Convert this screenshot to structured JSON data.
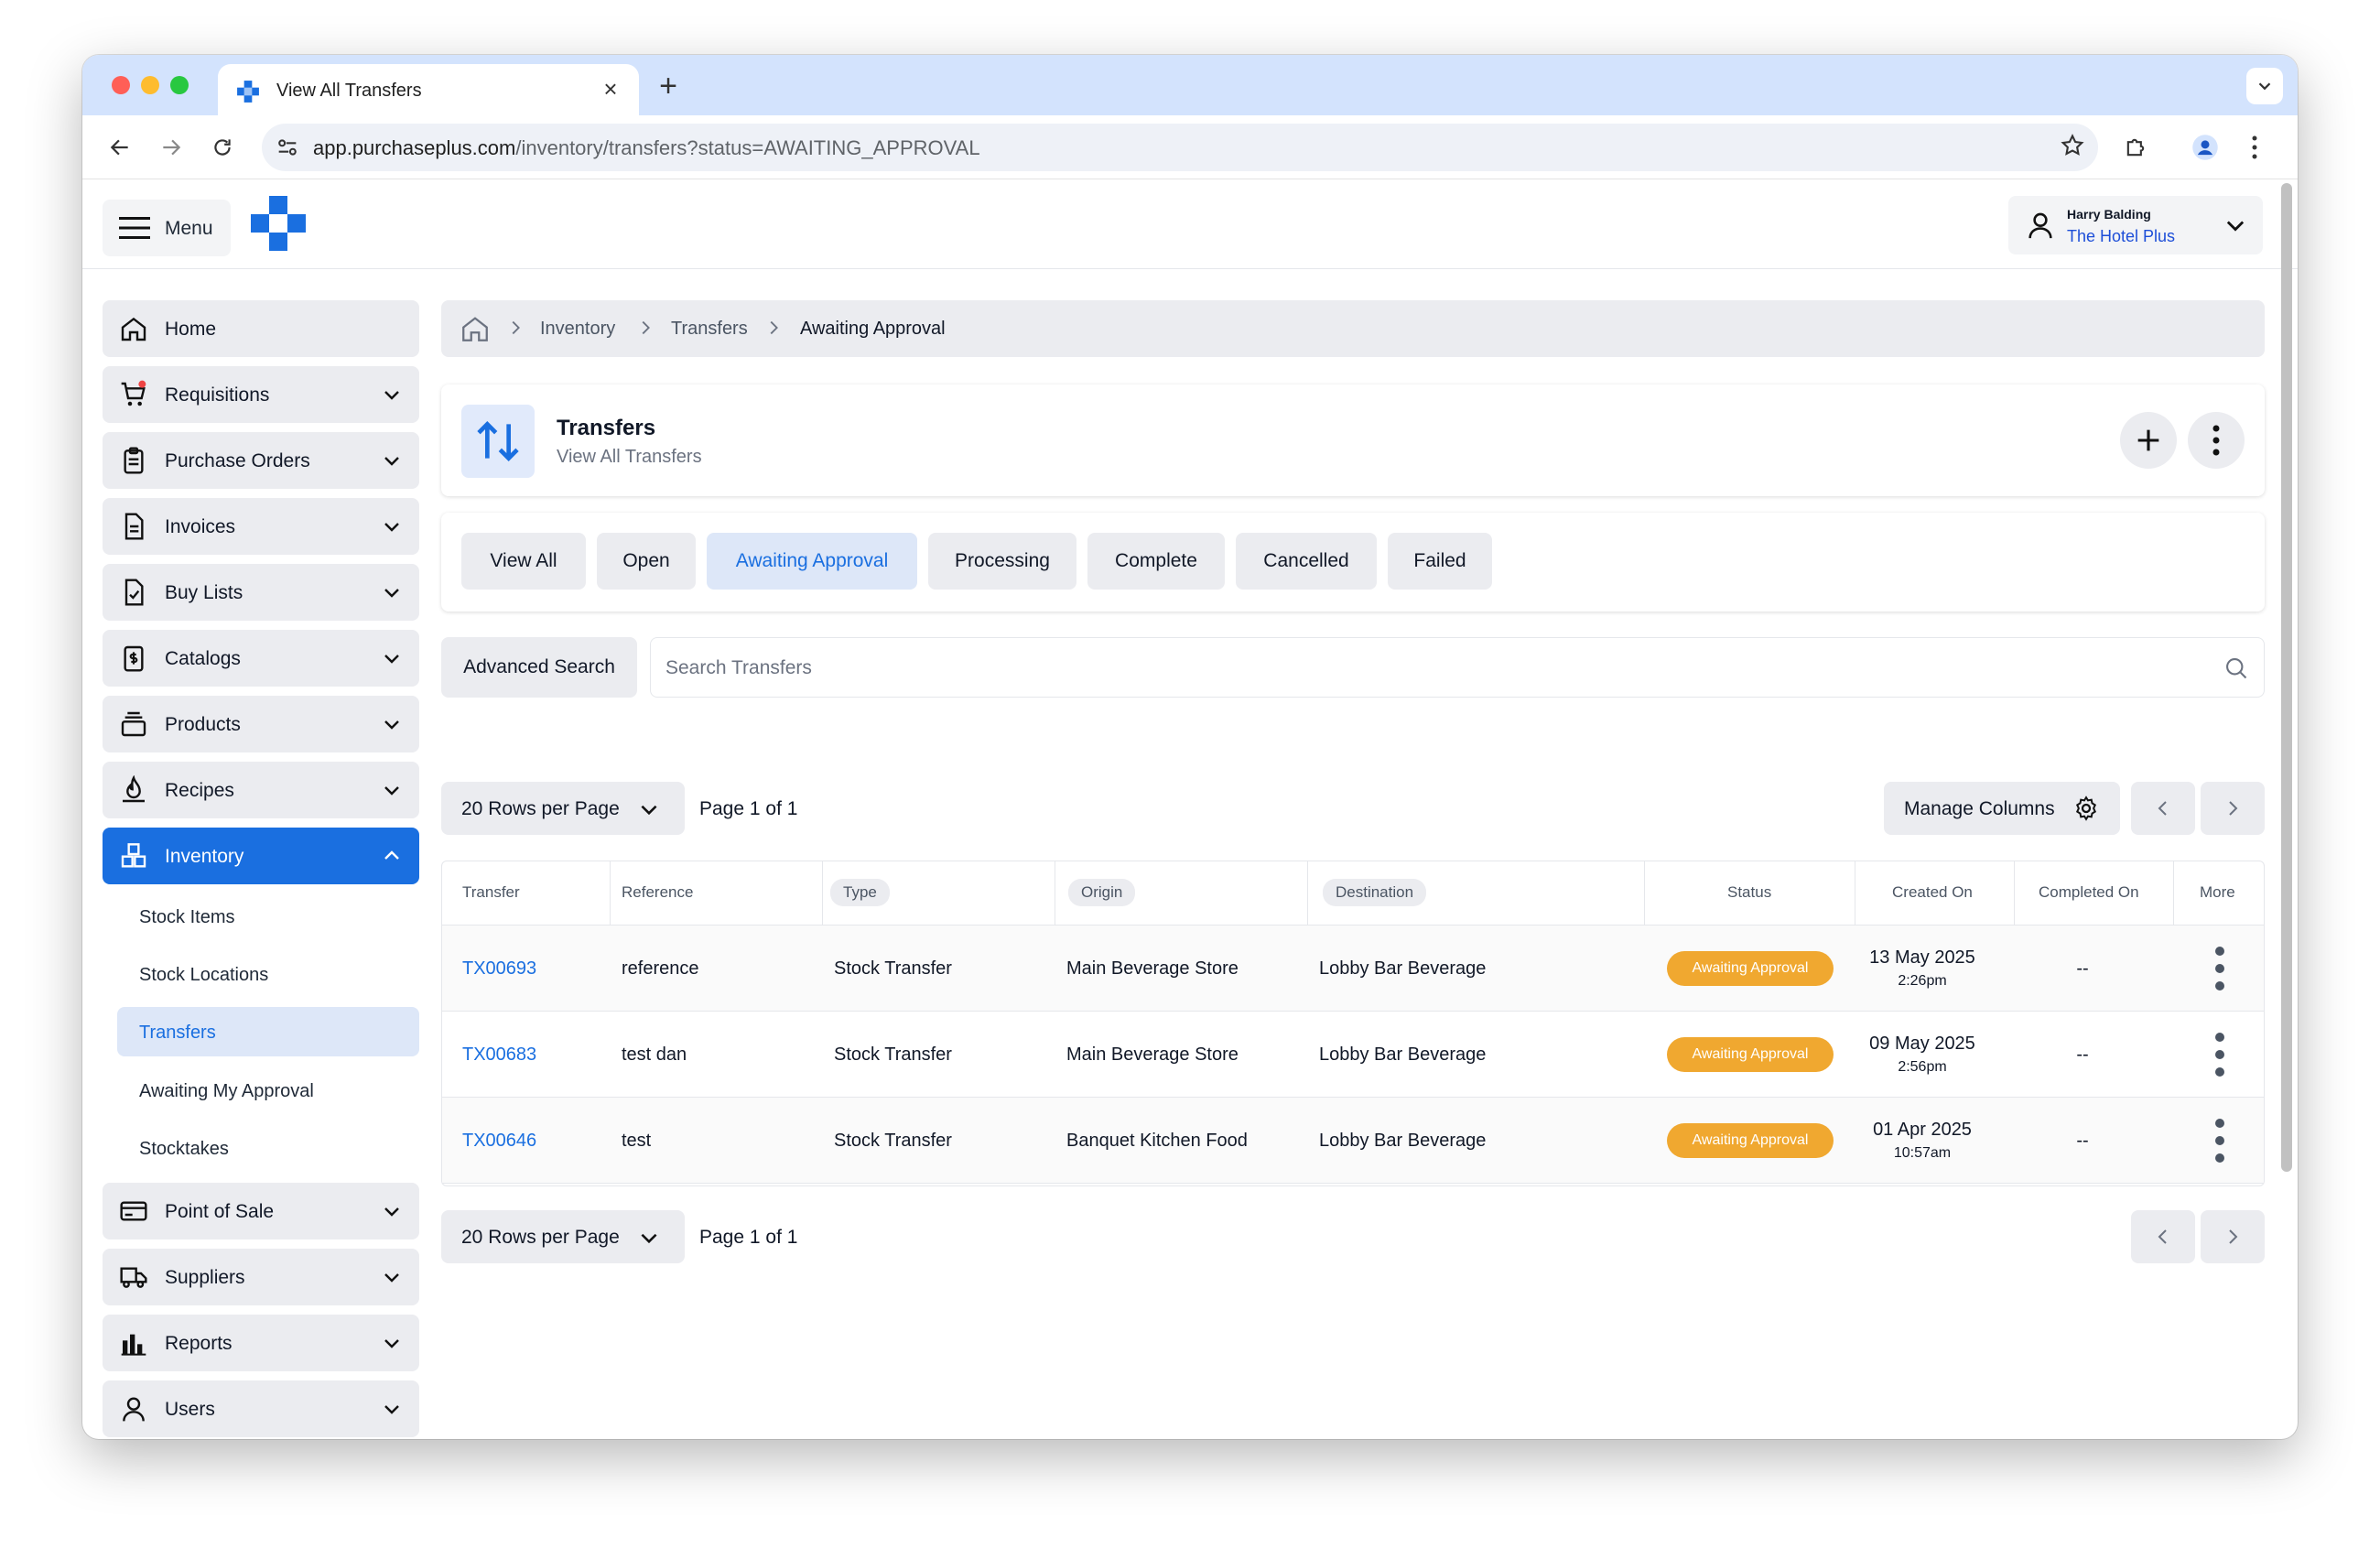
{
  "browser": {
    "tab_title": "View All Transfers",
    "tab_close": "×",
    "new_tab": "+",
    "url_host": "app.purchaseplus.com",
    "url_path": "/inventory/transfers?status=AWAITING_APPROVAL"
  },
  "header": {
    "menu_label": "Menu",
    "user_name": "Harry Balding",
    "user_org": "The Hotel Plus"
  },
  "sidebar": {
    "items": [
      {
        "label": "Home",
        "icon": "home-icon"
      },
      {
        "label": "Requisitions",
        "icon": "cart-icon"
      },
      {
        "label": "Purchase Orders",
        "icon": "clipboard-icon"
      },
      {
        "label": "Invoices",
        "icon": "document-icon"
      },
      {
        "label": "Buy Lists",
        "icon": "checklist-icon"
      },
      {
        "label": "Catalogs",
        "icon": "dollar-document-icon"
      },
      {
        "label": "Products",
        "icon": "box-stack-icon"
      },
      {
        "label": "Recipes",
        "icon": "flame-icon"
      },
      {
        "label": "Inventory",
        "icon": "inventory-icon"
      },
      {
        "label": "Point of Sale",
        "icon": "credit-card-icon"
      },
      {
        "label": "Suppliers",
        "icon": "truck-icon"
      },
      {
        "label": "Reports",
        "icon": "bar-chart-icon"
      },
      {
        "label": "Users",
        "icon": "user-icon"
      }
    ],
    "inventory_sub": [
      "Stock Items",
      "Stock Locations",
      "Transfers",
      "Awaiting My Approval",
      "Stocktakes"
    ]
  },
  "breadcrumb": [
    "Inventory",
    "Transfers",
    "Awaiting Approval"
  ],
  "page": {
    "title": "Transfers",
    "subtitle": "View All Transfers"
  },
  "filters": [
    "View All",
    "Open",
    "Awaiting Approval",
    "Processing",
    "Complete",
    "Cancelled",
    "Failed"
  ],
  "search": {
    "advanced_label": "Advanced Search",
    "placeholder": "Search Transfers"
  },
  "pagination": {
    "rows_label": "20 Rows per Page",
    "page_info": "Page 1 of 1",
    "manage_columns": "Manage Columns"
  },
  "table": {
    "columns": [
      "Transfer",
      "Reference",
      "Type",
      "Origin",
      "Destination",
      "Status",
      "Created On",
      "Completed On",
      "More"
    ],
    "rows": [
      {
        "transfer": "TX00693",
        "reference": "reference",
        "type": "Stock Transfer",
        "origin": "Main Beverage Store",
        "destination": "Lobby Bar Beverage",
        "status": "Awaiting Approval",
        "created_date": "13 May 2025",
        "created_time": "2:26pm",
        "completed": "--"
      },
      {
        "transfer": "TX00683",
        "reference": "test dan",
        "type": "Stock Transfer",
        "origin": "Main Beverage Store",
        "destination": "Lobby Bar Beverage",
        "status": "Awaiting Approval",
        "created_date": "09 May 2025",
        "created_time": "2:56pm",
        "completed": "--"
      },
      {
        "transfer": "TX00646",
        "reference": "test",
        "type": "Stock Transfer",
        "origin": "Banquet Kitchen Food",
        "destination": "Lobby Bar Beverage",
        "status": "Awaiting Approval",
        "created_date": "01 Apr 2025",
        "created_time": "10:57am",
        "completed": "--"
      }
    ]
  },
  "colors": {
    "primary": "#1a6fe0",
    "badge": "#f0a830",
    "active_light": "#dde7f8"
  }
}
